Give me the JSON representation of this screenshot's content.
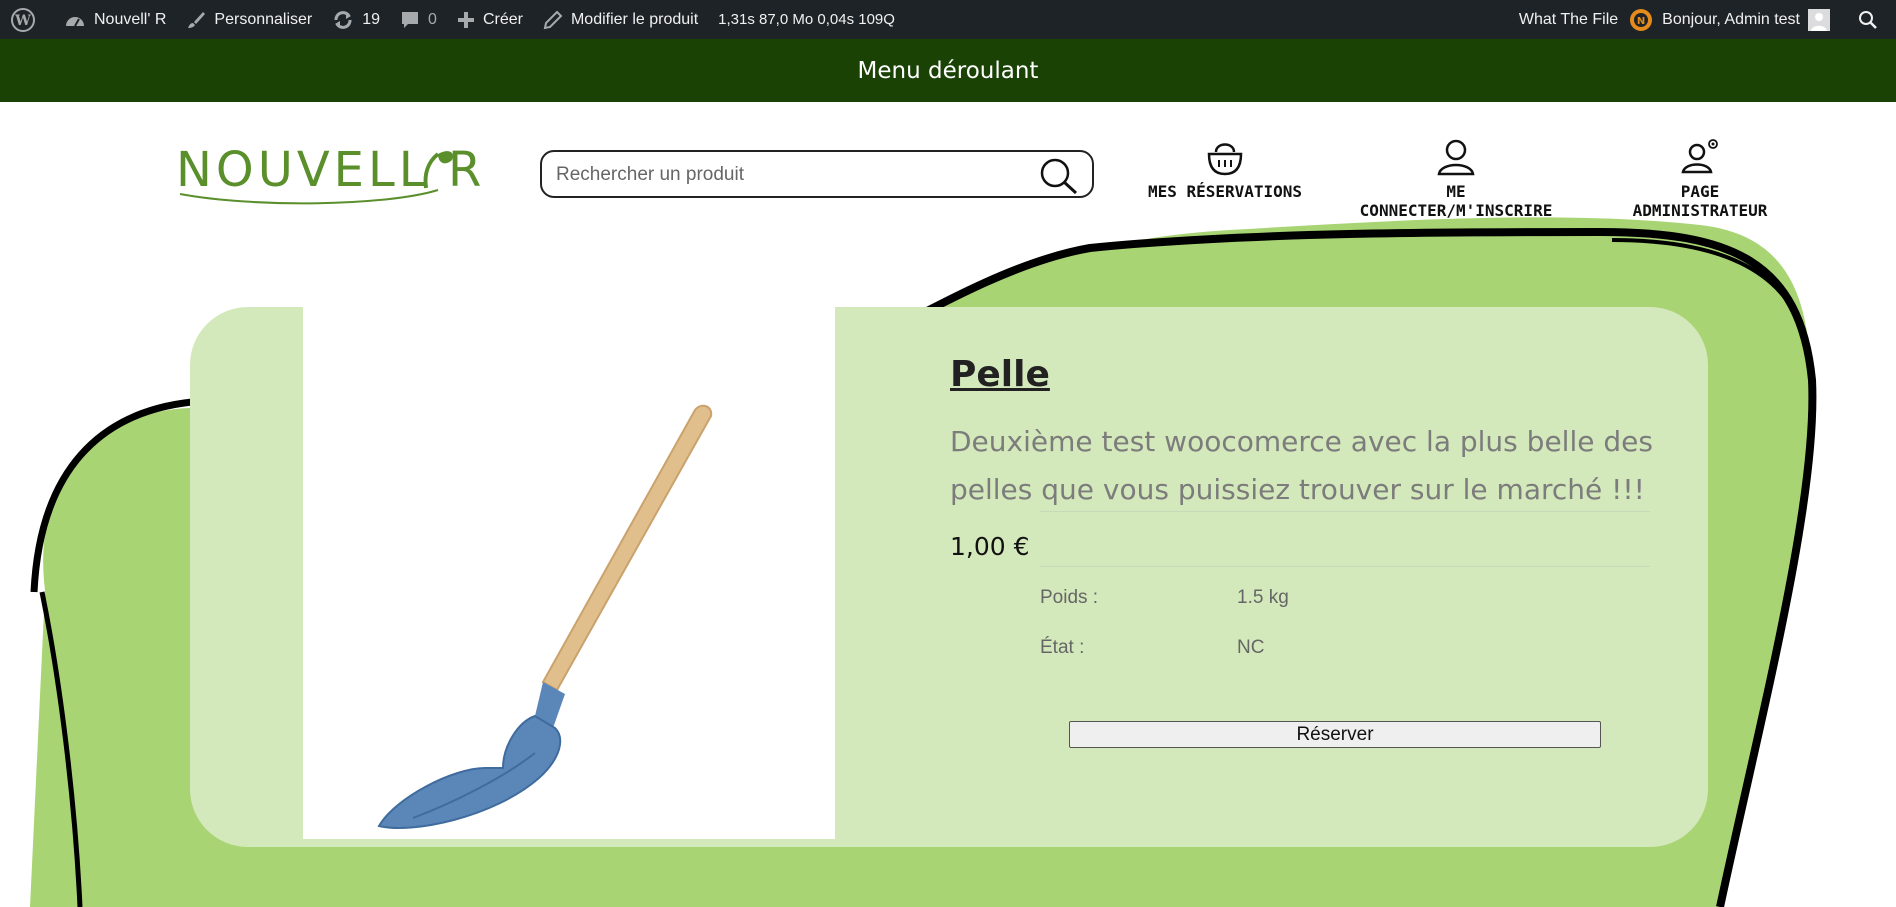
{
  "adminbar": {
    "site_name": "Nouvell' R",
    "customize": "Personnaliser",
    "updates_count": "19",
    "comments_count": "0",
    "new": "Créer",
    "edit_product": "Modifier le produit",
    "stats": "1,31s  87,0 Mo  0,04s  109Q",
    "what_the_file": "What The File",
    "greeting": "Bonjour, Admin test"
  },
  "banner": {
    "text": "Menu déroulant"
  },
  "header": {
    "search_placeholder": "Rechercher un produit",
    "nav": {
      "reservations": "MES RÉSERVATIONS",
      "login": "ME CONNECTER/M'INSCRIRE",
      "admin": "PAGE ADMINISTRATEUR"
    }
  },
  "product": {
    "title": "Pelle",
    "description": "Deuxième test woocomerce avec la plus belle des pelles que vous puissiez trouver sur le marché !!!",
    "price": "1,00 €",
    "attributes": [
      {
        "label": "Poids :",
        "value": "1.5 kg"
      },
      {
        "label": "État :",
        "value": "NC"
      }
    ],
    "reserve_button": "Réserver"
  },
  "colors": {
    "adminbar_bg": "#1d2327",
    "banner_bg": "#1a4205",
    "blob_green": "#a9d474",
    "panel_green": "#d4e9bb",
    "logo_green": "#5a8f2c"
  }
}
